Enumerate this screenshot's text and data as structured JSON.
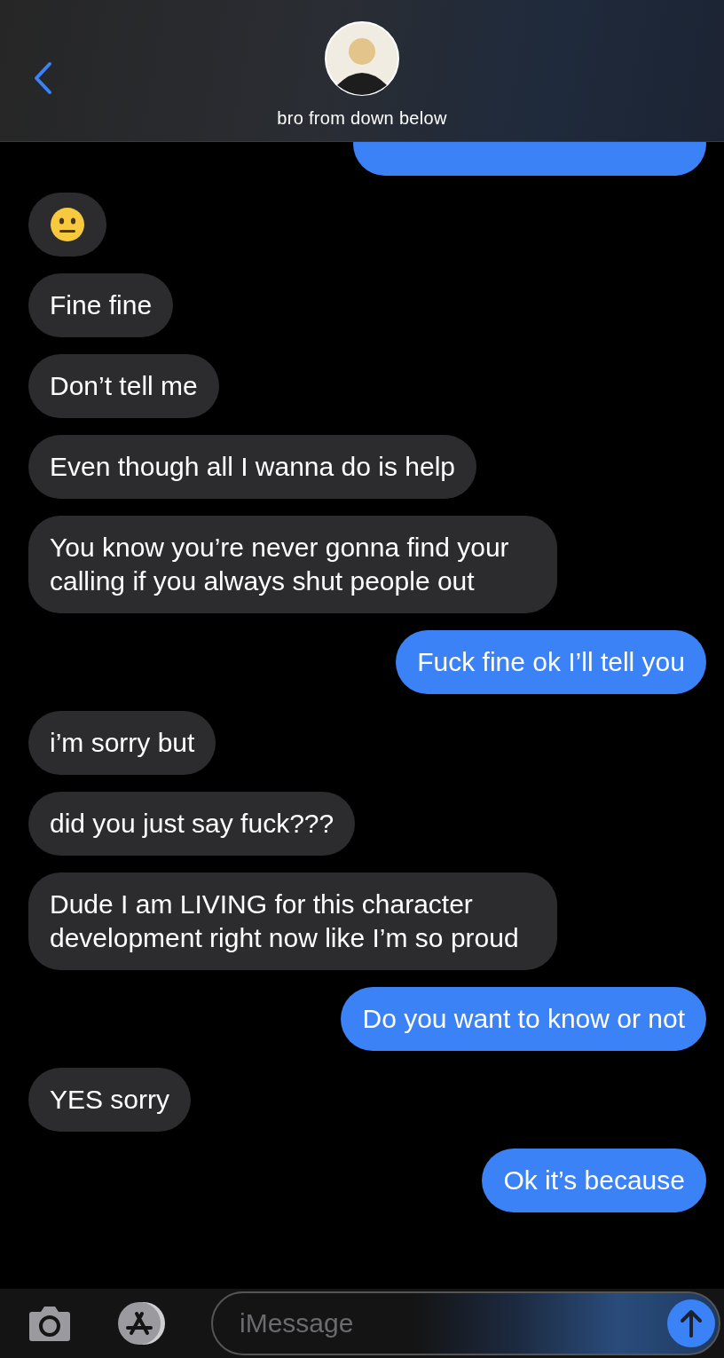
{
  "header": {
    "contact_name": "bro from down below"
  },
  "messages": [
    {
      "sent": true,
      "kind": "clipped"
    },
    {
      "sent": false,
      "kind": "emoji"
    },
    {
      "sent": false,
      "kind": "text",
      "text": "Fine fine"
    },
    {
      "sent": false,
      "kind": "text",
      "text": "Don’t tell me"
    },
    {
      "sent": false,
      "kind": "text",
      "text": "Even though all I wanna do is help"
    },
    {
      "sent": false,
      "kind": "text",
      "text": "You know you’re never gonna find your calling if you always shut people out"
    },
    {
      "sent": true,
      "kind": "text",
      "text": "Fuck fine ok I’ll tell you"
    },
    {
      "sent": false,
      "kind": "text",
      "text": "i’m sorry but"
    },
    {
      "sent": false,
      "kind": "text",
      "text": "did you just say fuck???"
    },
    {
      "sent": false,
      "kind": "text",
      "text": "Dude I am LIVING for this character development right now like I’m so proud"
    },
    {
      "sent": true,
      "kind": "text",
      "text": "Do you want to know or not"
    },
    {
      "sent": false,
      "kind": "text",
      "text": "YES sorry"
    },
    {
      "sent": true,
      "kind": "text",
      "text": "Ok it’s because"
    }
  ],
  "composer": {
    "placeholder": "iMessage"
  }
}
